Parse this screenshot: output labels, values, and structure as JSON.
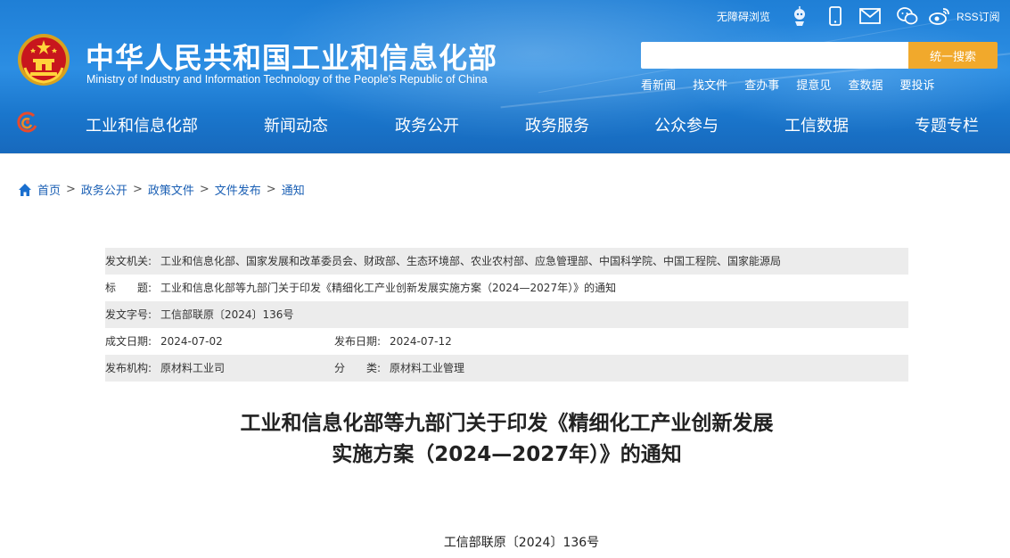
{
  "header": {
    "site_title": "中华人民共和国工业和信息化部",
    "site_subtitle": "Ministry of Industry and Information Technology of the People's Republic of China",
    "accessibility": "无障碍浏览",
    "rss": "RSS订阅",
    "icons": [
      "robot-icon",
      "mobile-icon",
      "mail-icon",
      "wechat-icon",
      "weibo-icon"
    ],
    "search": {
      "placeholder": "",
      "value": "",
      "button": "统一搜索"
    },
    "quick_links": [
      "看新闻",
      "找文件",
      "查办事",
      "提意见",
      "查数据",
      "要投诉"
    ]
  },
  "nav": {
    "items": [
      "工业和信息化部",
      "新闻动态",
      "政务公开",
      "政务服务",
      "公众参与",
      "工信数据",
      "专题专栏"
    ]
  },
  "breadcrumb": [
    "首页",
    "政务公开",
    "政策文件",
    "文件发布",
    "通知"
  ],
  "meta": {
    "issuer_label": "发文机关:",
    "issuer": "工业和信息化部、国家发展和改革委员会、财政部、生态环境部、农业农村部、应急管理部、中国科学院、中国工程院、国家能源局",
    "title_label": "标　　题:",
    "title": "工业和信息化部等九部门关于印发《精细化工产业创新发展实施方案（2024—2027年）》的通知",
    "doc_no_label": "发文字号:",
    "doc_no": "工信部联原〔2024〕136号",
    "created_label": "成文日期:",
    "created": "2024-07-02",
    "published_label": "发布日期:",
    "published": "2024-07-12",
    "org_label": "发布机构:",
    "org": "原材料工业司",
    "category_label": "分　　类:",
    "category": "原材料工业管理"
  },
  "document": {
    "title_line1": "工业和信息化部等九部门关于印发《精细化工产业创新发展",
    "title_line2": "实施方案（2024—2027年）》的通知",
    "doc_number": "工信部联原〔2024〕136号"
  },
  "colors": {
    "header_blue": "#1f7fd6",
    "search_button": "#f1a92c",
    "link_blue": "#1a5fb4"
  }
}
